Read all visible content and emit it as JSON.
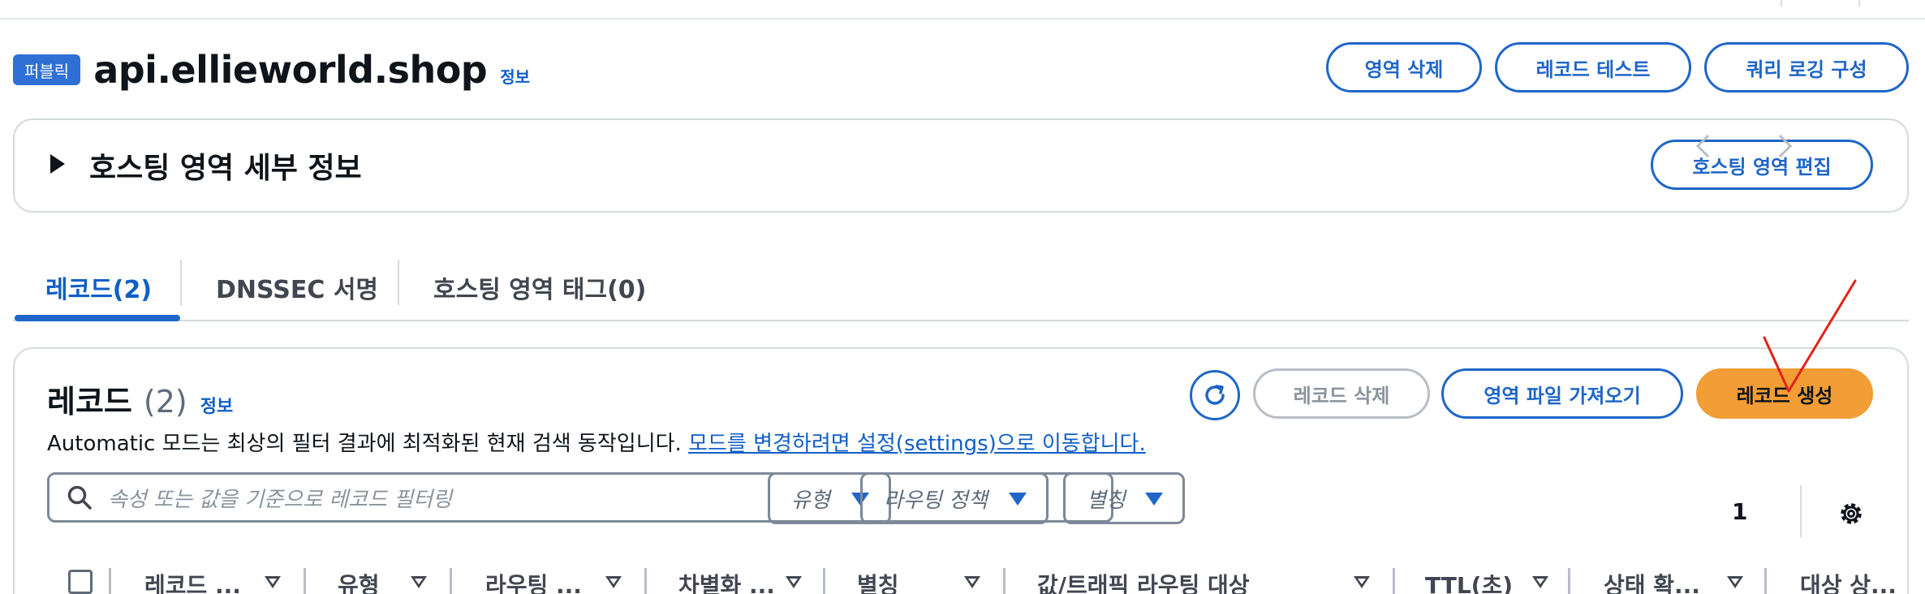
{
  "header": {
    "badge": "퍼블릭",
    "zone_name": "api.ellieworld.shop",
    "info": "정보",
    "buttons": {
      "delete_zone": "영역 삭제",
      "test_record": "레코드 테스트",
      "query_logging": "쿼리 로깅 구성"
    }
  },
  "details_panel": {
    "title": "호스팅 영역 세부 정보",
    "edit_button": "호스팅 영역 편집"
  },
  "tabs": [
    {
      "label": "레코드(2)",
      "active": true
    },
    {
      "label": "DNSSEC 서명",
      "active": false
    },
    {
      "label": "호스팅 영역 태그(0)",
      "active": false
    }
  ],
  "records": {
    "title": "레코드",
    "count": "(2)",
    "info": "정보",
    "description": "Automatic 모드는 최상의 필터 결과에 최적화된 현재 검색 동작입니다.",
    "settings_link": "모드를 변경하려면 설정(settings)으로 이동합니다.",
    "buttons": {
      "delete": "레코드 삭제",
      "import_zone": "영역 파일 가져오기",
      "create": "레코드 생성"
    },
    "search_placeholder": "속성 또는 값을 기준으로 레코드 필터링",
    "filters": [
      "유형",
      "라우팅 정책",
      "별칭"
    ],
    "page": "1",
    "columns": [
      "레코드 ...",
      "유형",
      "라우팅 ...",
      "차별화 ...",
      "별칭",
      "값/트래픽 라우팅 대상",
      "TTL(초)",
      "상태 확...",
      "대상 상..."
    ]
  },
  "colors": {
    "accent": "#1f66c8",
    "primary_button": "#f29d35",
    "annotation": "#e2231a"
  }
}
